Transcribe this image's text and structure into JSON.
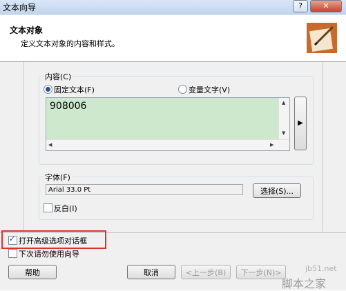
{
  "window": {
    "title": "文本向导",
    "help_label": "?",
    "close_label": "✕"
  },
  "header": {
    "title": "文本对象",
    "description": "定义文本对象的内容和样式。",
    "icon": "pen-paper-icon"
  },
  "content_group": {
    "label": "内容(C)",
    "radio_fixed": {
      "label": "固定文本(F)",
      "selected": true
    },
    "radio_variable": {
      "label": "变量文字(V)",
      "selected": false
    },
    "text_value": "908006",
    "side_button_label": "▶"
  },
  "font_group": {
    "label": "字体(F)",
    "font_value": "Arial 33.0 Pt",
    "choose_button_label": "选择(S)...",
    "reverse_label": "反白(I)",
    "reverse_checked": false
  },
  "options": {
    "open_advanced_label": "打开高级选项对话框",
    "open_advanced_checked": true,
    "no_wizard_label": "下次请勿使用向导",
    "no_wizard_checked": false
  },
  "footer": {
    "help_label": "帮助",
    "cancel_label": "取消",
    "prev_label": "<上一步(B)",
    "next_label": "下一步(N)>",
    "watermark_site": "jb51.net",
    "watermark_brand": "脚本之家"
  },
  "colors": {
    "text_area_bg": "#cde8cd",
    "highlight_border": "#d9342b"
  }
}
